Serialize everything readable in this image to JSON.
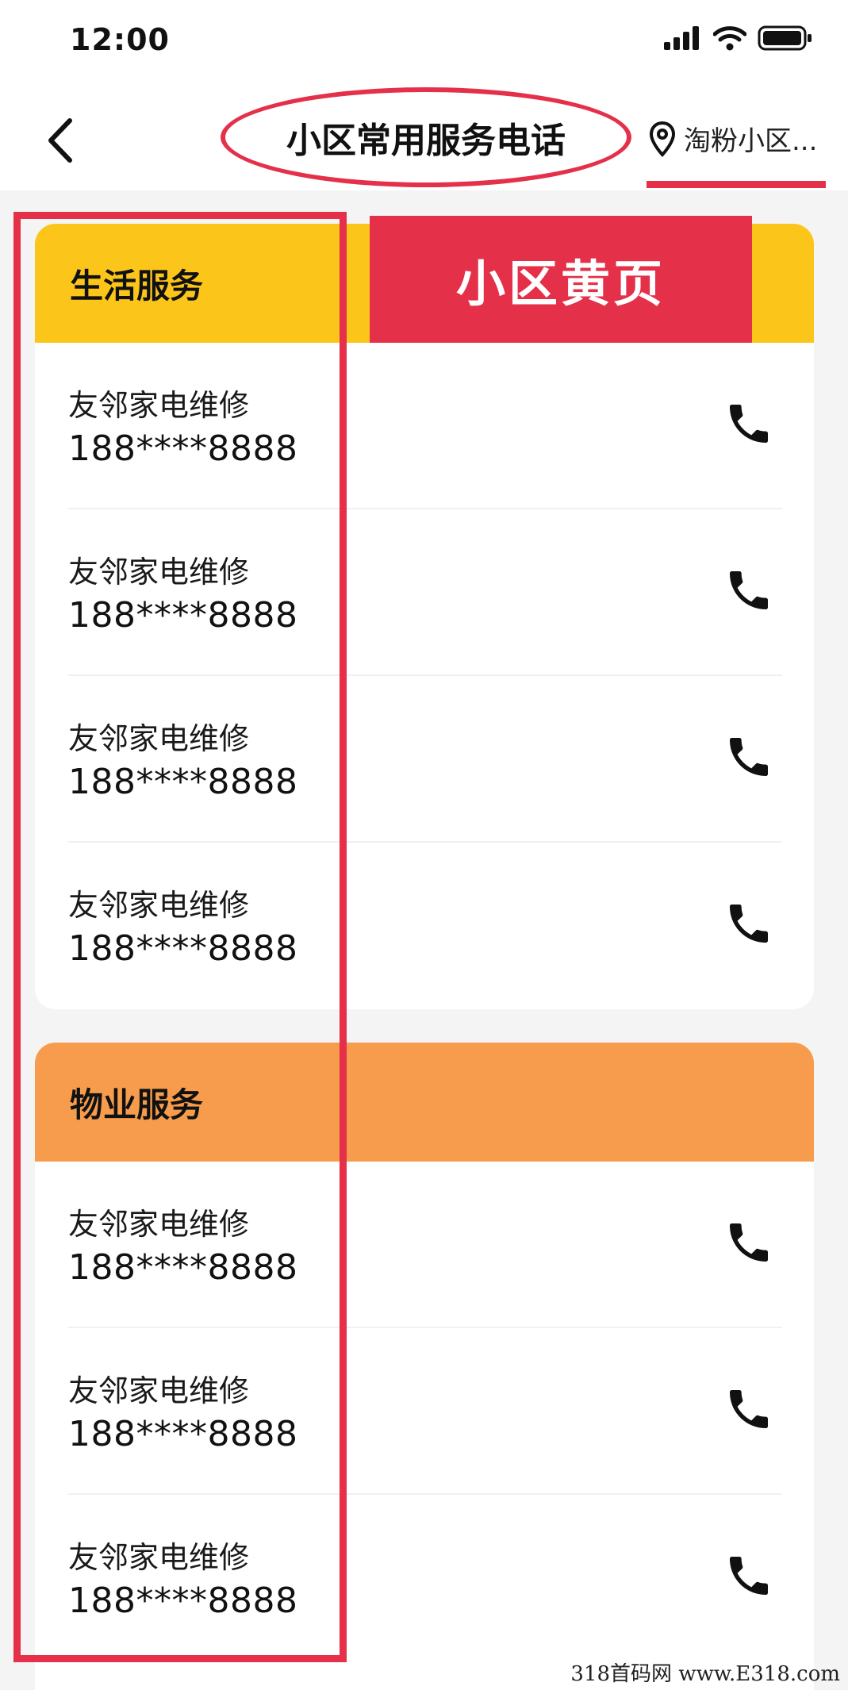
{
  "status_bar": {
    "time": "12:00"
  },
  "nav": {
    "title": "小区常用服务电话",
    "location": "淘粉小区..."
  },
  "banner": {
    "label": "小区黄页"
  },
  "sections": [
    {
      "title": "生活服务",
      "color": "#fcc51a",
      "items": [
        {
          "name": "友邻家电维修",
          "phone": "188****8888"
        },
        {
          "name": "友邻家电维修",
          "phone": "188****8888"
        },
        {
          "name": "友邻家电维修",
          "phone": "188****8888"
        },
        {
          "name": "友邻家电维修",
          "phone": "188****8888"
        }
      ]
    },
    {
      "title": "物业服务",
      "color": "#f79c4c",
      "items": [
        {
          "name": "友邻家电维修",
          "phone": "188****8888"
        },
        {
          "name": "友邻家电维修",
          "phone": "188****8888"
        },
        {
          "name": "友邻家电维修",
          "phone": "188****8888"
        }
      ]
    }
  ],
  "watermark": "318首码网 www.E318.com",
  "colors": {
    "annotation_red": "#e5304a",
    "background": "#f4f4f5"
  },
  "icons": [
    "signal-icon",
    "wifi-icon",
    "battery-icon",
    "back-arrow-icon",
    "location-pin-icon",
    "phone-icon"
  ]
}
